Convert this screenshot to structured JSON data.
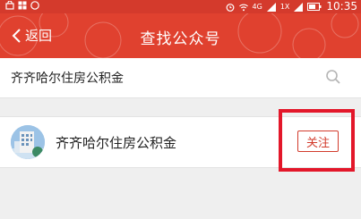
{
  "status_bar": {
    "network_label": "4G",
    "signal_label": "1X",
    "time": "10:35"
  },
  "header": {
    "back_label": "返回",
    "title": "查找公众号"
  },
  "search": {
    "value": "齐齐哈尔住房公积金",
    "icon": "search-icon"
  },
  "results": [
    {
      "name": "齐齐哈尔住房公积金",
      "follow_label": "关注"
    }
  ],
  "colors": {
    "header_red": "#e0412f",
    "status_red": "#d43a2c",
    "highlight_red": "#e3172a",
    "button_red": "#d23b2c"
  }
}
